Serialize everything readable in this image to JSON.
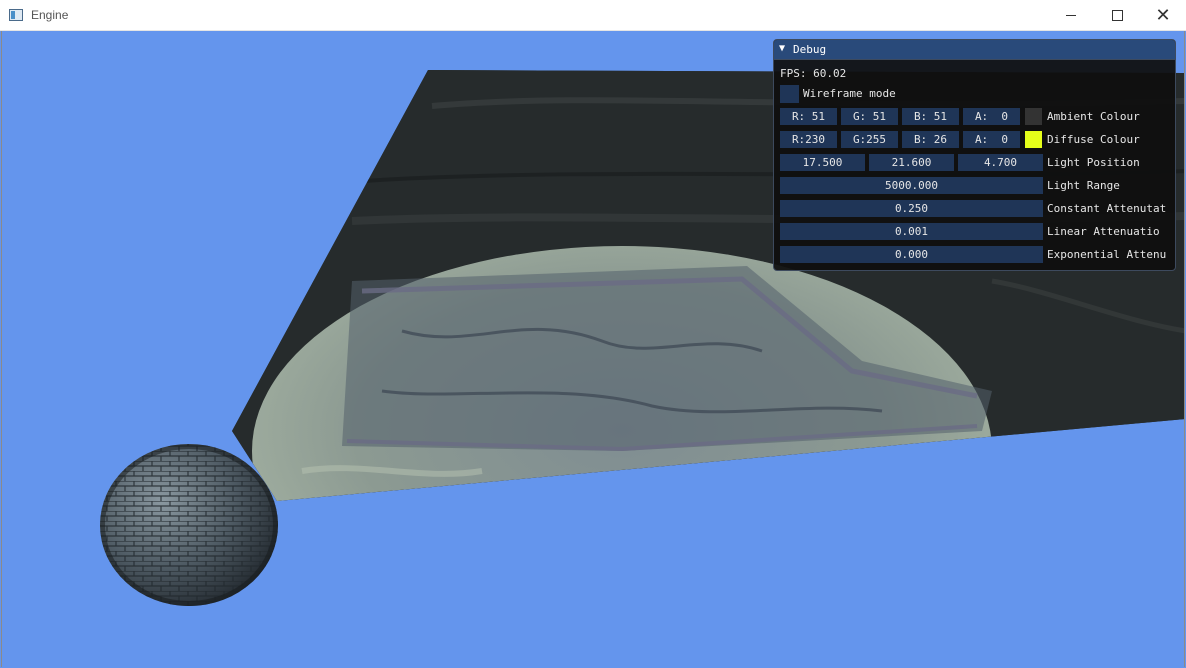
{
  "window": {
    "title": "Engine",
    "minimize_glyph": "",
    "maximize_glyph": "",
    "close_glyph": "✕"
  },
  "scene": {
    "background_color": "#6495ed",
    "objects": [
      "textured-floor-plane",
      "brick-sphere"
    ]
  },
  "debug": {
    "title": "Debug",
    "collapse_glyph": "▼",
    "fps_text": "FPS: 60.02",
    "wireframe": {
      "label": "Wireframe mode",
      "checked": false
    },
    "ambient": {
      "label": "Ambient Colour",
      "fields": [
        "R: 51",
        "G: 51",
        "B: 51",
        "A:  0"
      ],
      "swatch_color": "#333333"
    },
    "diffuse": {
      "label": "Diffuse Colour",
      "fields": [
        "R:230",
        "G:255",
        "B: 26",
        "A:  0"
      ],
      "swatch_color": "#e6ff1a"
    },
    "light_position": {
      "label": "Light Position",
      "fields": [
        "17.500",
        "21.600",
        "4.700"
      ]
    },
    "light_range": {
      "label": "Light Range",
      "value": "5000.000"
    },
    "constant_attenuation": {
      "label": "Constant Attenutat",
      "value": "0.250"
    },
    "linear_attenuation": {
      "label": "Linear Attenuatio",
      "value": "0.001"
    },
    "exponential_attenuation": {
      "label": "Exponential Attenu",
      "value": "0.000"
    }
  }
}
